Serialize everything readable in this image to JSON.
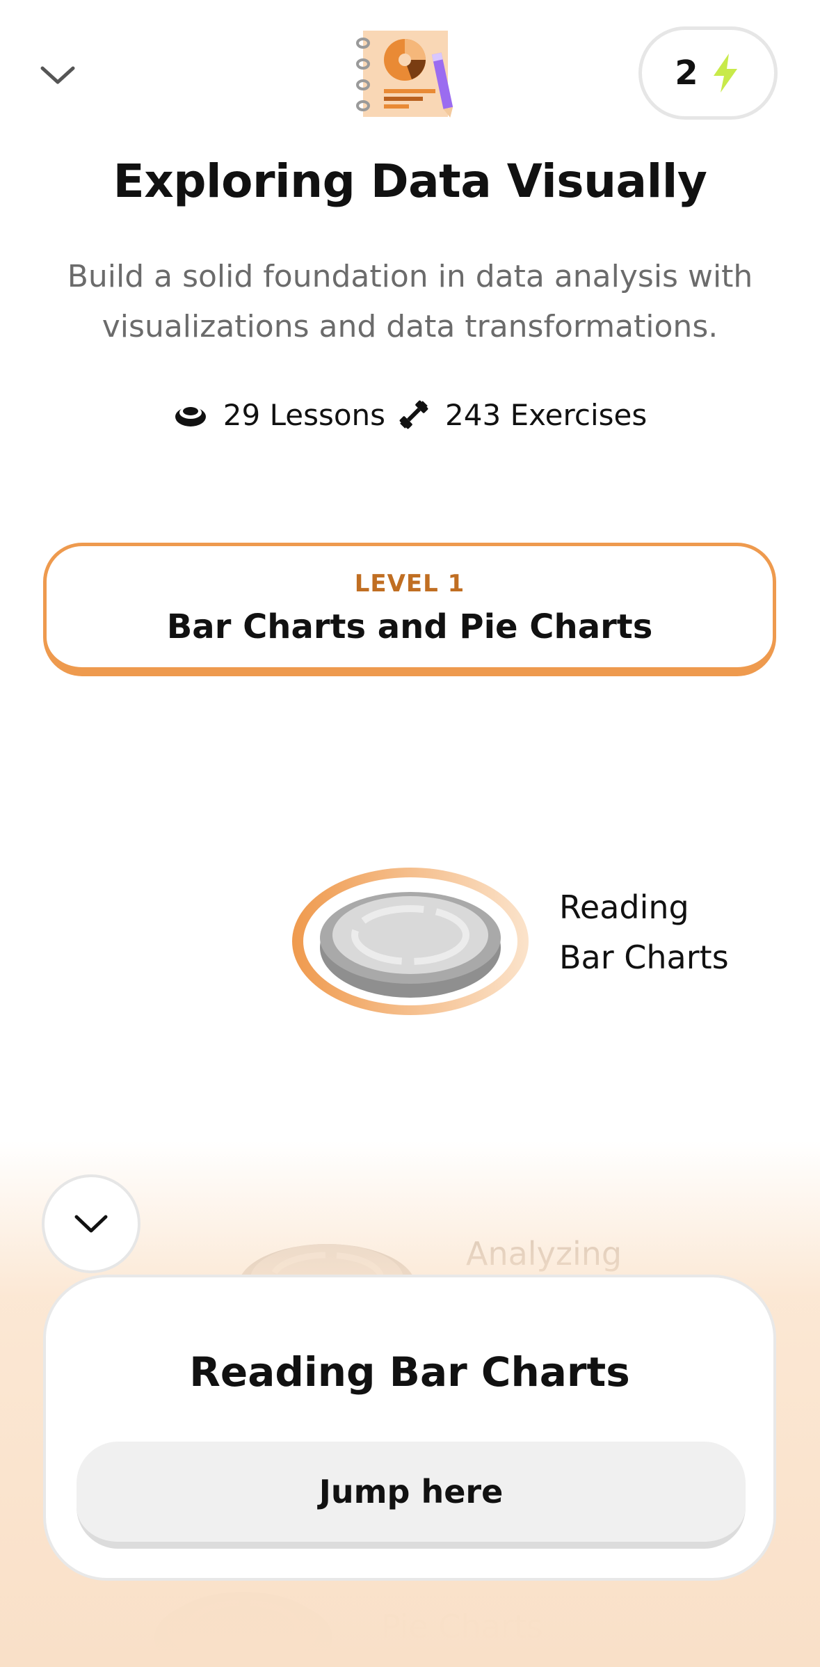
{
  "header": {
    "collapse_icon": "chevron-down-icon",
    "illustration": "notebook-pie-chart-illustration",
    "energy": {
      "count": "2",
      "icon": "lightning-bolt-icon",
      "color": "#c8ea4a"
    }
  },
  "course": {
    "title": "Exploring Data Visually",
    "description": "Build a solid foundation in data analysis with visualizations and data transformations.",
    "lessons": "29 Lessons",
    "exercises": "243 Exercises",
    "lessons_icon": "lessons-stack-icon",
    "exercises_icon": "dumbbell-icon"
  },
  "level": {
    "label": "LEVEL 1",
    "title": "Bar Charts and Pie Charts",
    "accent": "#ee9a4e"
  },
  "path": {
    "nodes": [
      {
        "label_line1": "Reading",
        "label_line2": "Bar Charts",
        "state": "current"
      },
      {
        "label_line1": "Analyzing",
        "state": "locked"
      },
      {
        "label_line1": "Pie Charts",
        "state": "locked"
      }
    ]
  },
  "popup": {
    "title": "Reading Bar Charts",
    "button_label": "Jump here"
  },
  "scroll_icon": "chevron-down-icon"
}
